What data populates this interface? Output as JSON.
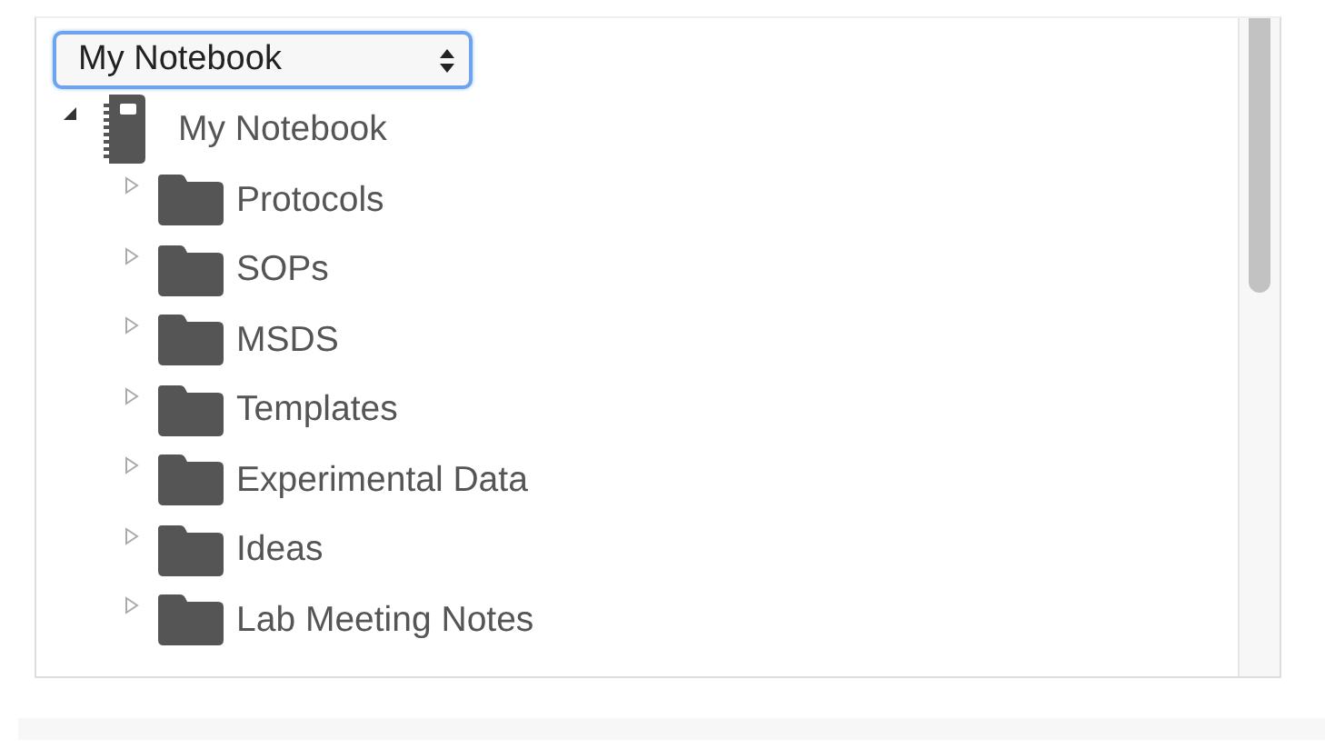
{
  "notebook_select": {
    "value": "My Notebook"
  },
  "tree": [
    {
      "label": "My Notebook",
      "kind": "notebook",
      "expanded": true,
      "children": [
        {
          "label": "Protocols",
          "kind": "folder",
          "expanded": false
        },
        {
          "label": "SOPs",
          "kind": "folder",
          "expanded": false
        },
        {
          "label": "MSDS",
          "kind": "folder",
          "expanded": false
        },
        {
          "label": "Templates",
          "kind": "folder",
          "expanded": false
        },
        {
          "label": "Experimental Data",
          "kind": "folder",
          "expanded": false
        },
        {
          "label": "Ideas",
          "kind": "folder",
          "expanded": false
        },
        {
          "label": "Lab Meeting Notes",
          "kind": "folder",
          "expanded": false
        }
      ]
    }
  ]
}
